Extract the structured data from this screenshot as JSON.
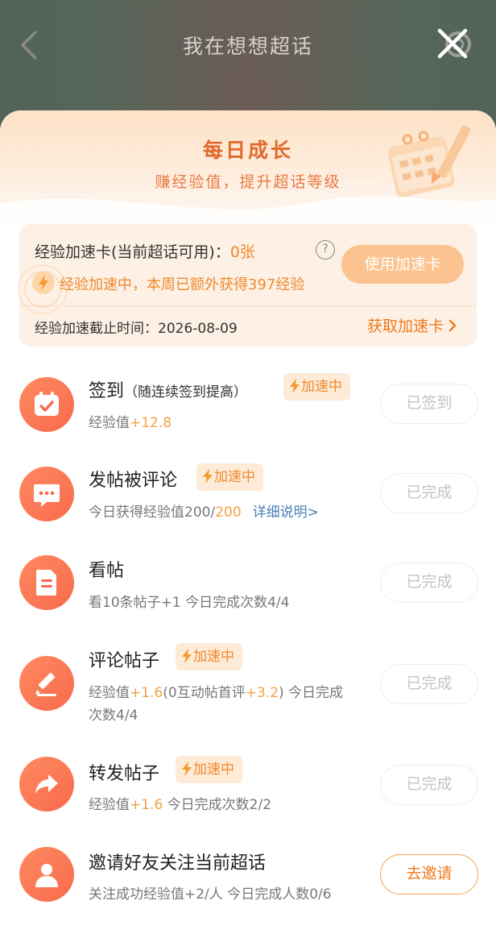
{
  "nav": {
    "title": "我在想想超话"
  },
  "hero": {
    "title": "每日成长",
    "subtitle": "赚经验值，提升超话等级"
  },
  "boost": {
    "card_label": "经验加速卡(当前超话可用)：",
    "card_count": "0张",
    "use_button": "使用加速卡",
    "speedup_text": "经验加速中，本周已额外获得397经验",
    "deadline_text": "经验加速截止时间：2026-08-09",
    "get_link": "获取加速卡"
  },
  "badge_label": "加速中",
  "tasks": [
    {
      "title": "签到",
      "title_note": "（随连续签到提高）",
      "sub_prefix": "经验值",
      "sub_highlight": "+12.8",
      "button": "已签到",
      "icon": "calendar-check-icon"
    },
    {
      "title": "发帖被评论",
      "sub_prefix": "今日获得经验值200/",
      "sub_highlight": "200",
      "sub_link": "详细说明>",
      "button": "已完成",
      "icon": "chat-bubble-icon"
    },
    {
      "title": "看帖",
      "sub_prefix": "看10条帖子+1  今日完成次数4/4",
      "button": "已完成",
      "icon": "document-icon"
    },
    {
      "title": "评论帖子",
      "sub_prefix": "经验值",
      "sub_highlight": "+1.6",
      "sub_mid": "(0互动帖首评",
      "sub_highlight2": "+3.2",
      "sub_end": ")  今日完成",
      "sub_line2": "次数4/4",
      "button": "已完成",
      "icon": "pencil-icon"
    },
    {
      "title": "转发帖子",
      "sub_prefix": "经验值",
      "sub_highlight": "+1.6",
      "sub_end": "  今日完成次数2/2",
      "button": "已完成",
      "icon": "share-arrow-icon"
    },
    {
      "title": "邀请好友关注当前超话",
      "sub_prefix": "关注成功经验值+2/人  今日完成人数0/6",
      "button": "去邀请",
      "icon": "user-icon"
    }
  ],
  "colors": {
    "accent": "#ef7a1e",
    "highlight": "#f0a245",
    "link": "#4a7fb5",
    "icon_bg": "#f86a4d"
  }
}
